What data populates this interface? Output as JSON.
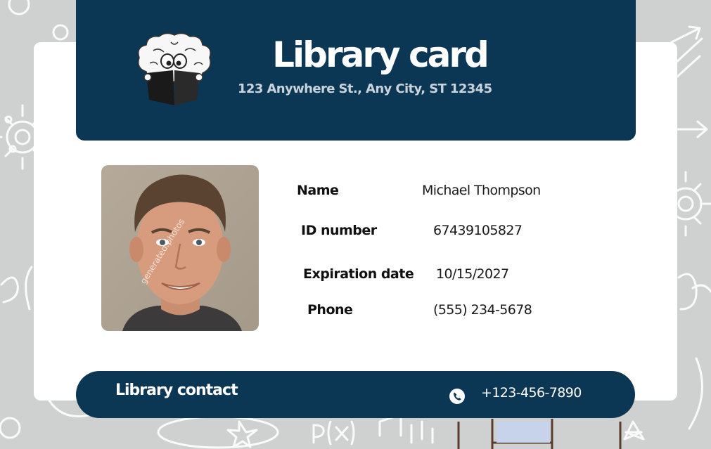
{
  "card": {
    "title": "Library card",
    "address": "123 Anywhere St., Any City, ST 12345"
  },
  "fields": {
    "name": {
      "label": "Name",
      "value": "Michael Thompson"
    },
    "id": {
      "label": "ID number",
      "value": "67439105827"
    },
    "expiration": {
      "label": "Expiration date",
      "value": "10/15/2027"
    },
    "phone": {
      "label": "Phone",
      "value": "(555) 234-5678"
    }
  },
  "photo": {
    "watermark": "generated.photos"
  },
  "footer": {
    "label": "Library contact",
    "phone": "+123-456-7890",
    "icon": "phone-icon"
  },
  "colors": {
    "primary": "#0b3654",
    "background": "#cfd0d0",
    "card": "#ffffff",
    "address_text": "#c9d3dc"
  }
}
